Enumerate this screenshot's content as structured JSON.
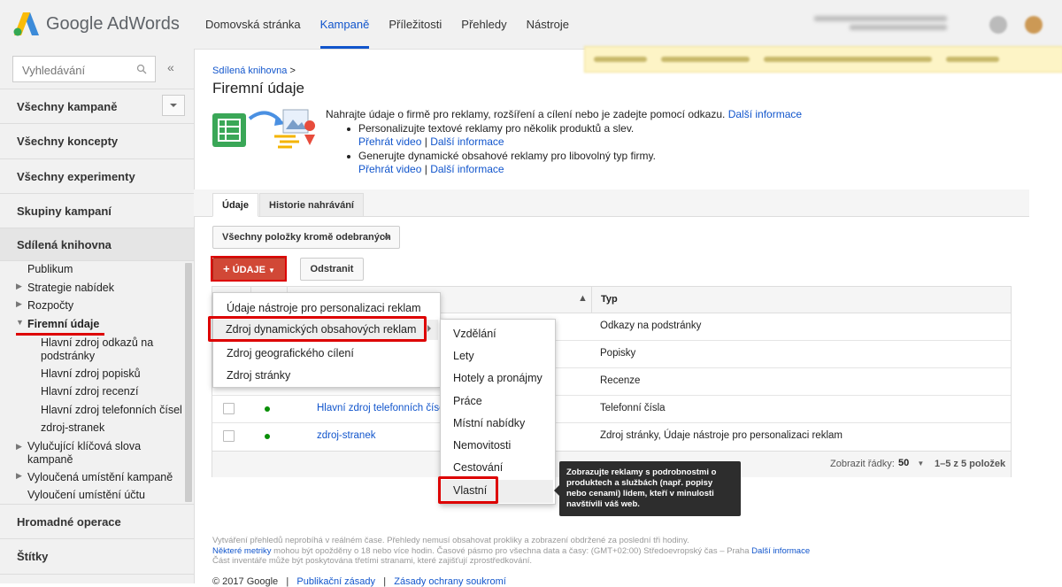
{
  "app": {
    "name": "Google AdWords"
  },
  "topnav": {
    "items": [
      {
        "label": "Domovská stránka"
      },
      {
        "label": "Kampaně"
      },
      {
        "label": "Příležitosti"
      },
      {
        "label": "Přehledy"
      },
      {
        "label": "Nástroje"
      }
    ],
    "active_index": 1
  },
  "sidebar": {
    "search_placeholder": "Vyhledávání",
    "collapse_glyph": "«",
    "sections": [
      {
        "label": "Všechny kampaně"
      },
      {
        "label": "Všechny koncepty"
      },
      {
        "label": "Všechny experimenty"
      },
      {
        "label": "Skupiny kampaní"
      },
      {
        "label": "Sdílená knihovna"
      }
    ],
    "tree": [
      {
        "label": "Publikum"
      },
      {
        "label": "Strategie nabídek"
      },
      {
        "label": "Rozpočty"
      },
      {
        "label": "Firemní údaje"
      },
      {
        "label": "Hlavní zdroj odkazů na podstránky"
      },
      {
        "label": "Hlavní zdroj popisků"
      },
      {
        "label": "Hlavní zdroj recenzí"
      },
      {
        "label": "Hlavní zdroj telefonních čísel"
      },
      {
        "label": "zdroj-stranek"
      },
      {
        "label": "Vylučující klíčová slova kampaně"
      },
      {
        "label": "Vyloučená umístění kampaně"
      },
      {
        "label": "Vyloučení umístění účtu"
      }
    ],
    "bottom": [
      {
        "label": "Hromadné operace"
      },
      {
        "label": "Štítky"
      }
    ]
  },
  "breadcrumb": {
    "label": "Sdílená knihovna",
    "sep": ">"
  },
  "page_title": "Firemní údaje",
  "intro": {
    "text": "Nahrajte údaje o firmě pro reklamy, rozšíření a cílení nebo je zadejte pomocí odkazu.",
    "more_link": "Další informace",
    "bullets": [
      {
        "text": "Personalizujte textové reklamy pro několik produktů a slev.",
        "video": "Přehrát video",
        "sep": "|",
        "more": "Další informace"
      },
      {
        "text": "Generujte dynamické obsahové reklamy pro libovolný typ firmy.",
        "video": "Přehrát video",
        "sep": "|",
        "more": "Další informace"
      }
    ]
  },
  "tabs": [
    {
      "label": "Údaje"
    },
    {
      "label": "Historie nahrávání"
    }
  ],
  "toolbar": {
    "filter_label": "Všechny položky kromě odebraných",
    "add_label": "ÚDAJE",
    "remove_label": "Odstranit"
  },
  "table": {
    "type_header": "Typ",
    "rows": [
      {
        "name": "",
        "type": "Odkazy na podstránky"
      },
      {
        "name": "",
        "type": "Popisky"
      },
      {
        "name": "",
        "type": "Recenze"
      },
      {
        "name": "Hlavní zdroj telefonních čísel",
        "type": "Telefonní čísla"
      },
      {
        "name": "zdroj-stranek",
        "type": "Zdroj stránky, Údaje nástroje pro personalizaci reklam"
      }
    ],
    "footer": {
      "rows_label": "Zobrazit řádky:",
      "rows_value": "50",
      "pagination": "1–5 z 5 položek"
    }
  },
  "menu": {
    "items": [
      {
        "label": "Údaje nástroje pro personalizaci reklam"
      },
      {
        "label": "Zdroj dynamických obsahových reklam"
      },
      {
        "label": "Zdroj geografického cílení"
      },
      {
        "label": "Zdroj stránky"
      }
    ]
  },
  "submenu": {
    "items": [
      {
        "label": "Vzdělání"
      },
      {
        "label": "Lety"
      },
      {
        "label": "Hotely a pronájmy"
      },
      {
        "label": "Práce"
      },
      {
        "label": "Místní nabídky"
      },
      {
        "label": "Nemovitosti"
      },
      {
        "label": "Cestování"
      },
      {
        "label": "Vlastní"
      }
    ]
  },
  "tooltip": "Zobrazujte reklamy s podrobnostmi o produktech a službách (např. popisy nebo cenami) lidem, kteří v minulosti navštívili váš web.",
  "footnote": {
    "line1": "Vytváření přehledů neprobíhá v reálném čase. Přehledy nemusí obsahovat prokliky a zobrazení obdržené za poslední tři hodiny.",
    "line2_link": "Některé metriky",
    "line2": " mohou být opožděny o 18 nebo více hodin. Časové pásmo pro všechna data a časy: (GMT+02:00) Středoevropský čas – Praha ",
    "line2_more": "Další informace",
    "line3": "Část inventáře může být poskytována třetími stranami, které zajišťují zprostředkování."
  },
  "copyright": {
    "text": "© 2017 Google",
    "sep": "|",
    "link1": "Publikační zásady",
    "link2": "Zásady ochrany soukromí"
  },
  "colors": {
    "accent": "#1155cc",
    "brand_red": "#d14836",
    "highlight": "#dd0000",
    "active_green": "#0a8f08"
  }
}
